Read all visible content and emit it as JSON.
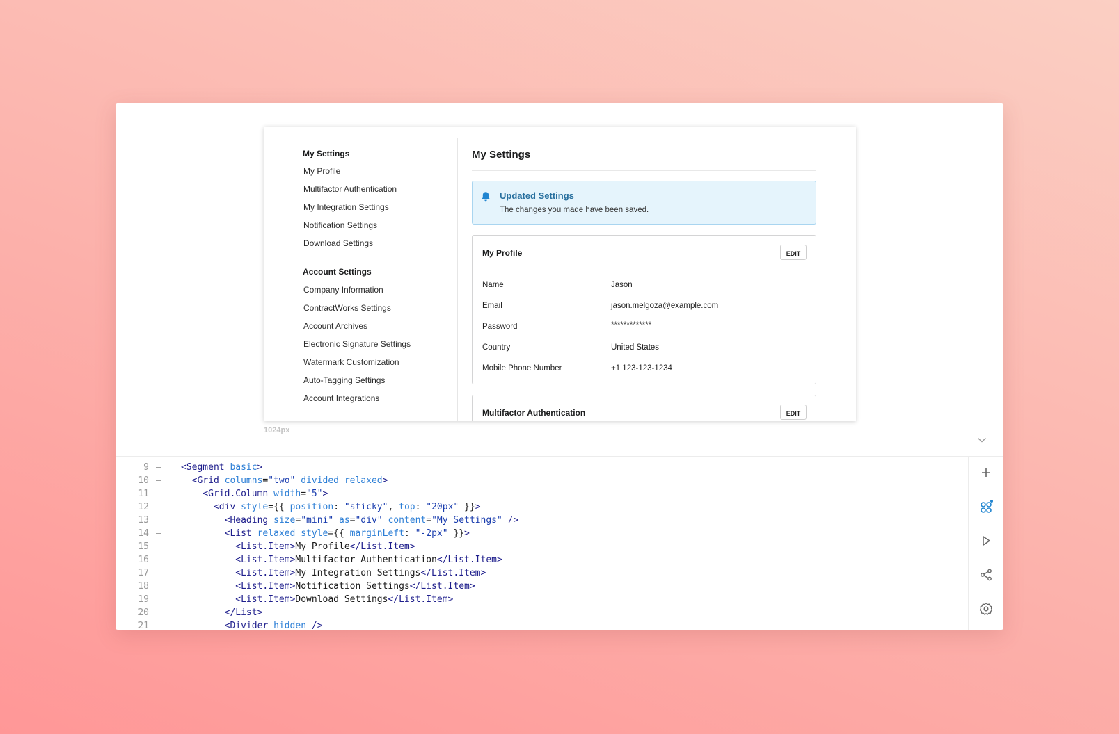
{
  "preview": {
    "frame_width_label": "1024px",
    "nav": {
      "group1": {
        "heading": "My Settings",
        "items": [
          "My Profile",
          "Multifactor Authentication",
          "My Integration Settings",
          "Notification Settings",
          "Download Settings"
        ]
      },
      "group2": {
        "heading": "Account Settings",
        "items": [
          "Company Information",
          "ContractWorks Settings",
          "Account Archives",
          "Electronic Signature Settings",
          "Watermark Customization",
          "Auto-Tagging Settings",
          "Account Integrations"
        ]
      }
    },
    "main": {
      "title": "My Settings",
      "message": {
        "header": "Updated Settings",
        "text": "The changes you made have been saved."
      },
      "profile_card": {
        "title": "My Profile",
        "edit_label": "EDIT",
        "rows": [
          {
            "label": "Name",
            "value": "Jason"
          },
          {
            "label": "Email",
            "value": "jason.melgoza@example.com"
          },
          {
            "label": "Password",
            "value": "*************"
          },
          {
            "label": "Country",
            "value": "United States"
          },
          {
            "label": "Mobile Phone Number",
            "value": "+1 123-123-1234"
          }
        ]
      },
      "mfa_card": {
        "title": "Multifactor Authentication",
        "edit_label": "EDIT"
      }
    }
  },
  "editor": {
    "lines": [
      {
        "n": "9",
        "fold": "–",
        "tokens": [
          [
            "tg",
            "<Segment "
          ],
          [
            "at",
            "basic"
          ],
          [
            "tg",
            ">"
          ]
        ]
      },
      {
        "n": "10",
        "fold": "–",
        "tokens": [
          [
            "tx",
            "  "
          ],
          [
            "tg",
            "<Grid "
          ],
          [
            "at",
            "columns"
          ],
          [
            "tx",
            "="
          ],
          [
            "st",
            "\"two\" "
          ],
          [
            "at",
            "divided relaxed"
          ],
          [
            "tg",
            ">"
          ]
        ]
      },
      {
        "n": "11",
        "fold": "–",
        "tokens": [
          [
            "tx",
            "    "
          ],
          [
            "tg",
            "<Grid.Column "
          ],
          [
            "at",
            "width"
          ],
          [
            "tx",
            "="
          ],
          [
            "st",
            "\"5\""
          ],
          [
            "tg",
            ">"
          ]
        ]
      },
      {
        "n": "12",
        "fold": "–",
        "tokens": [
          [
            "tx",
            "      "
          ],
          [
            "tg",
            "<div "
          ],
          [
            "at",
            "style"
          ],
          [
            "tx",
            "={{ "
          ],
          [
            "at",
            "position"
          ],
          [
            "tx",
            ": "
          ],
          [
            "st",
            "\"sticky\""
          ],
          [
            "tx",
            ", "
          ],
          [
            "at",
            "top"
          ],
          [
            "tx",
            ": "
          ],
          [
            "st",
            "\"20px\""
          ],
          [
            "tx",
            " }}"
          ],
          [
            "tg",
            ">"
          ]
        ]
      },
      {
        "n": "13",
        "fold": "",
        "tokens": [
          [
            "tx",
            "        "
          ],
          [
            "tg",
            "<Heading "
          ],
          [
            "at",
            "size"
          ],
          [
            "tx",
            "="
          ],
          [
            "st",
            "\"mini\" "
          ],
          [
            "at",
            "as"
          ],
          [
            "tx",
            "="
          ],
          [
            "st",
            "\"div\" "
          ],
          [
            "at",
            "content"
          ],
          [
            "tx",
            "="
          ],
          [
            "st",
            "\"My Settings\" "
          ],
          [
            "tg",
            "/>"
          ]
        ]
      },
      {
        "n": "14",
        "fold": "–",
        "tokens": [
          [
            "tx",
            "        "
          ],
          [
            "tg",
            "<List "
          ],
          [
            "at",
            "relaxed style"
          ],
          [
            "tx",
            "={{ "
          ],
          [
            "at",
            "marginLeft"
          ],
          [
            "tx",
            ": "
          ],
          [
            "st",
            "\"-2px\""
          ],
          [
            "tx",
            " }}"
          ],
          [
            "tg",
            ">"
          ]
        ]
      },
      {
        "n": "15",
        "fold": "",
        "tokens": [
          [
            "tx",
            "          "
          ],
          [
            "tg",
            "<List.Item>"
          ],
          [
            "tx",
            "My Profile"
          ],
          [
            "tg",
            "</List.Item>"
          ]
        ]
      },
      {
        "n": "16",
        "fold": "",
        "tokens": [
          [
            "tx",
            "          "
          ],
          [
            "tg",
            "<List.Item>"
          ],
          [
            "tx",
            "Multifactor Authentication"
          ],
          [
            "tg",
            "</List.Item>"
          ]
        ]
      },
      {
        "n": "17",
        "fold": "",
        "tokens": [
          [
            "tx",
            "          "
          ],
          [
            "tg",
            "<List.Item>"
          ],
          [
            "tx",
            "My Integration Settings"
          ],
          [
            "tg",
            "</List.Item>"
          ]
        ]
      },
      {
        "n": "18",
        "fold": "",
        "tokens": [
          [
            "tx",
            "          "
          ],
          [
            "tg",
            "<List.Item>"
          ],
          [
            "tx",
            "Notification Settings"
          ],
          [
            "tg",
            "</List.Item>"
          ]
        ]
      },
      {
        "n": "19",
        "fold": "",
        "tokens": [
          [
            "tx",
            "          "
          ],
          [
            "tg",
            "<List.Item>"
          ],
          [
            "tx",
            "Download Settings"
          ],
          [
            "tg",
            "</List.Item>"
          ]
        ]
      },
      {
        "n": "20",
        "fold": "",
        "tokens": [
          [
            "tx",
            "        "
          ],
          [
            "tg",
            "</List>"
          ]
        ]
      },
      {
        "n": "21",
        "fold": "",
        "tokens": [
          [
            "tx",
            "        "
          ],
          [
            "tg",
            "<Divider "
          ],
          [
            "at",
            "hidden "
          ],
          [
            "tg",
            "/>"
          ]
        ]
      }
    ],
    "toolbar": {
      "icons": [
        "plus-icon",
        "components-icon",
        "play-icon",
        "share-icon",
        "gear-icon"
      ]
    }
  },
  "colors": {
    "accent_blue": "#2d7fd6",
    "message_bg": "#e5f4fc",
    "message_header": "#276f9e"
  }
}
